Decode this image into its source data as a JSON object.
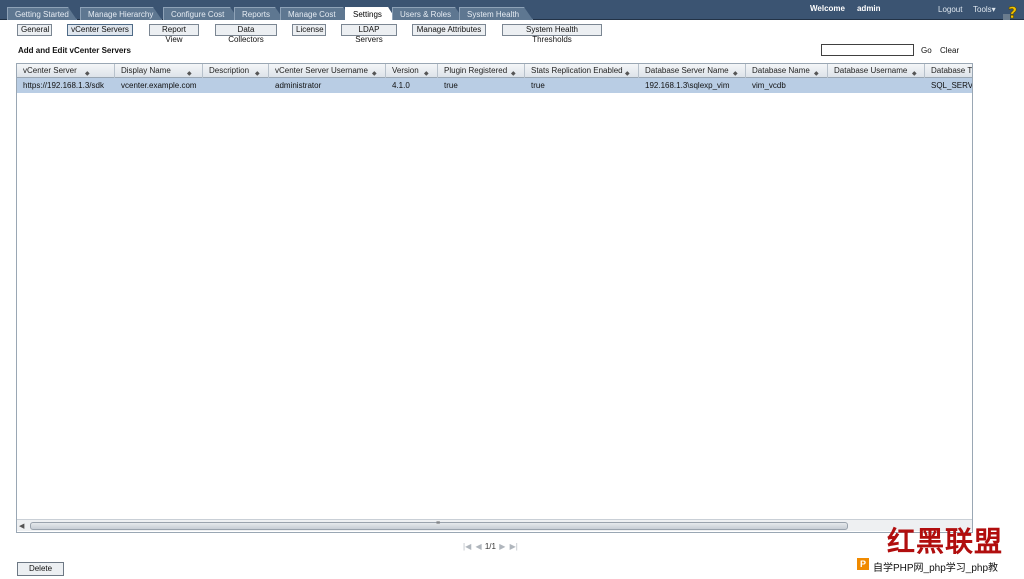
{
  "tabs": [
    {
      "label": "Getting Started"
    },
    {
      "label": "Manage Hierarchy"
    },
    {
      "label": "Configure Cost"
    },
    {
      "label": "Reports"
    },
    {
      "label": "Manage Cost"
    },
    {
      "label": "Settings",
      "active": true
    },
    {
      "label": "Users & Roles"
    },
    {
      "label": "System Health"
    }
  ],
  "header": {
    "welcome_label": "Welcome",
    "username": "admin",
    "logout": "Logout",
    "tools": "Tools▾",
    "help_icon": "help-question-icon"
  },
  "subnav": [
    {
      "label": "General"
    },
    {
      "label": "vCenter Servers",
      "active": true
    },
    {
      "label": "Report View"
    },
    {
      "label": "Data Collectors"
    },
    {
      "label": "License"
    },
    {
      "label": "LDAP Servers"
    },
    {
      "label": "Manage Attributes"
    },
    {
      "label": "System Health Thresholds"
    }
  ],
  "page": {
    "title": "Add and Edit vCenter Servers",
    "search_value": "",
    "go": "Go",
    "clear": "Clear"
  },
  "table": {
    "columns": [
      "vCenter Server",
      "Display Name",
      "Description",
      "vCenter Server Username",
      "Version",
      "Plugin Registered",
      "Stats Replication Enabled",
      "Database Server Name",
      "Database Name",
      "Database Username",
      "Database Ty"
    ],
    "rows": [
      [
        "https://192.168.1.3/sdk",
        "vcenter.example.com",
        "",
        "administrator",
        "4.1.0",
        "true",
        "true",
        "192.168.1.3\\sqlexp_vim",
        "vim_vcdb",
        "",
        "SQL_SERVER"
      ]
    ]
  },
  "scrollbar": {
    "grip": "≡"
  },
  "pager": {
    "first": "|◀",
    "prev": "◀",
    "page": "1/1",
    "next": "▶",
    "last": "▶|"
  },
  "actions": {
    "delete": "Delete"
  },
  "watermark": {
    "logo_text": "红黑联盟",
    "badge": "P",
    "site_text": "自学PHP网_php学习_php教"
  }
}
